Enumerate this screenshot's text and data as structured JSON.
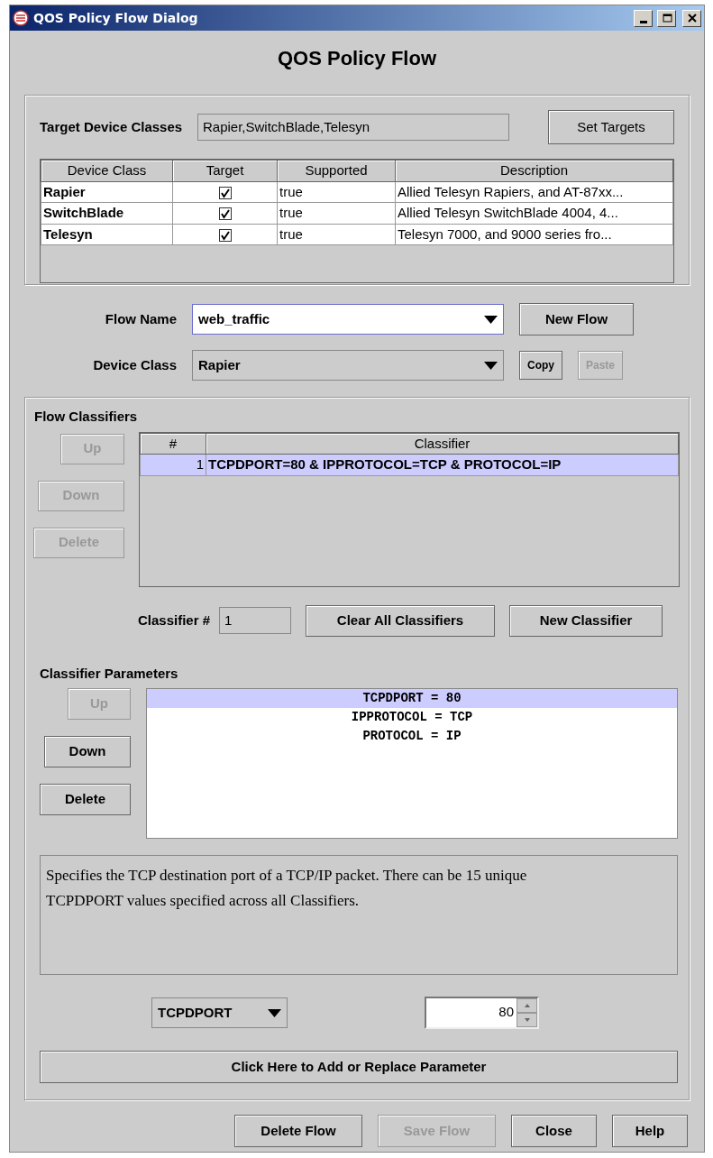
{
  "window": {
    "title": "QOS Policy Flow Dialog"
  },
  "heading": "QOS Policy Flow",
  "targets": {
    "label": "Target Device Classes",
    "value": "Rapier,SwitchBlade,Telesyn",
    "button": {
      "label": "Set Targets",
      "disabled": false
    }
  },
  "device_table": {
    "columns": [
      "Device Class",
      "Target",
      "Supported",
      "Description"
    ],
    "rows": [
      {
        "device_class": "Rapier",
        "target": true,
        "supported": "true",
        "description": "Allied Telesyn Rapiers, and AT-87xx..."
      },
      {
        "device_class": "SwitchBlade",
        "target": true,
        "supported": "true",
        "description": "Allied Telesyn SwitchBlade 4004, 4..."
      },
      {
        "device_class": "Telesyn",
        "target": true,
        "supported": "true",
        "description": "Telesyn 7000, and 9000 series fro..."
      }
    ]
  },
  "flow_name": {
    "label": "Flow Name",
    "value": "web_traffic",
    "button": {
      "label": "New Flow",
      "disabled": false
    }
  },
  "device_class": {
    "label": "Device Class",
    "value": "Rapier",
    "buttons": [
      {
        "label": "Copy",
        "disabled": false
      },
      {
        "label": "Paste",
        "disabled": true
      }
    ]
  },
  "flow_classifiers": {
    "title": "Flow Classifiers",
    "buttons": [
      {
        "label": "Up",
        "disabled": true
      },
      {
        "label": "Down",
        "disabled": true
      },
      {
        "label": "Delete",
        "disabled": true
      }
    ],
    "columns": [
      "#",
      "Classifier"
    ],
    "rows": [
      {
        "number": "1",
        "classifier": "TCPDPORT=80 & IPPROTOCOL=TCP & PROTOCOL=IP",
        "selected": true
      }
    ],
    "classifier_number": {
      "label": "Classifier #",
      "value": "1"
    },
    "actions": [
      {
        "label": "Clear All Classifiers",
        "disabled": false
      },
      {
        "label": "New Classifier",
        "disabled": false
      }
    ]
  },
  "classifier_parameters": {
    "title": "Classifier Parameters",
    "buttons": [
      {
        "label": "Up",
        "disabled": true
      },
      {
        "label": "Down",
        "disabled": false
      },
      {
        "label": "Delete",
        "disabled": false
      }
    ],
    "items": [
      {
        "text": "TCPDPORT = 80",
        "selected": true
      },
      {
        "text": "IPPROTOCOL = TCP",
        "selected": false
      },
      {
        "text": "PROTOCOL = IP",
        "selected": false
      }
    ],
    "description": "Specifies the TCP destination port of a TCP/IP packet.  There can be 15 unique TCPDPORT values specified across all Classifiers.",
    "parameter": "TCPDPORT",
    "value": "80",
    "add_button": {
      "label": "Click Here to Add or Replace Parameter",
      "disabled": false
    }
  },
  "footer_buttons": [
    {
      "label": "Delete Flow",
      "disabled": false
    },
    {
      "label": "Save Flow",
      "disabled": true
    },
    {
      "label": "Close",
      "disabled": false
    },
    {
      "label": "Help",
      "disabled": false
    }
  ]
}
